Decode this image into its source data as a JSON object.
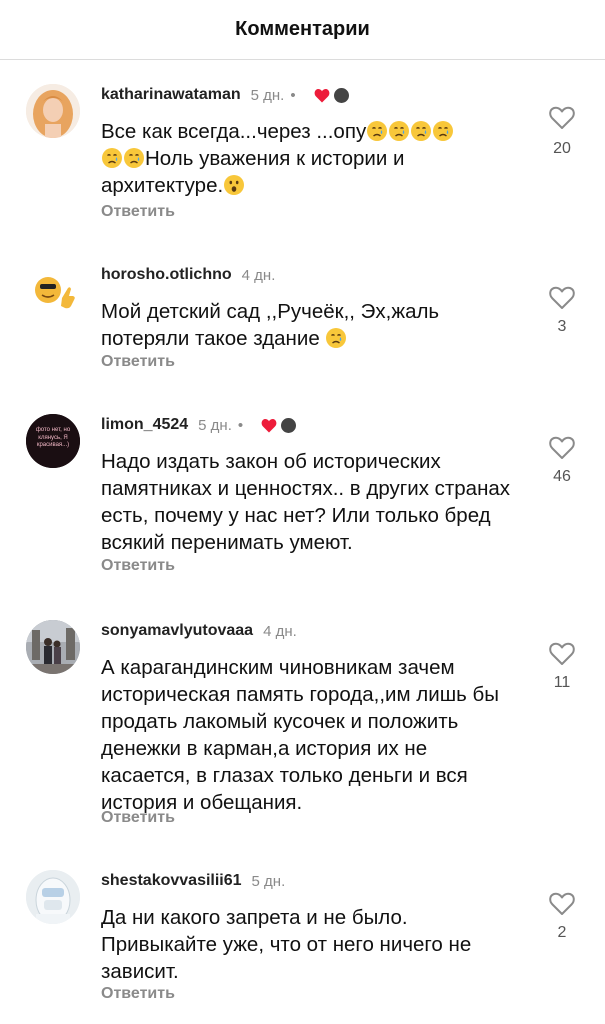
{
  "header": {
    "title": "Комментарии"
  },
  "reply_label": "Ответить",
  "comments": [
    {
      "username": "katharinawataman",
      "time": "5 дн.",
      "dot": "•",
      "text_parts": [
        "Все как всегда...через ...опу",
        "Ноль уважения к истории и архитектуре."
      ],
      "likes": "20",
      "author_liked": true
    },
    {
      "username": "horosho.otlichno",
      "time": "4 дн.",
      "text_parts": [
        "Мой детский сад ,,Ручеёк,, Эх,жаль потеряли такое здание "
      ],
      "likes": "3",
      "author_liked": false
    },
    {
      "username": "limon_4524",
      "time": "5 дн.",
      "dot": "•",
      "avatar_text": "фото нет, но клянусь, Я красивая...)",
      "text": "Надо издать закон об исторических памятниках и ценностях.. в других странах есть, почему у нас нет? Или только бред всякий перенимать умеют.",
      "likes": "46",
      "author_liked": true
    },
    {
      "username": "sonyamavlyutovaaa",
      "time": "4 дн.",
      "text": "А карагандинским чиновникам зачем историческая память города,,им лишь бы продать лакомый кусочек и положить денежки в карман,а история их не касается, в глазах только деньги и вся история и обещания.",
      "likes": "11",
      "author_liked": false
    },
    {
      "username": "shestakovvasilii61",
      "time": "5 дн.",
      "text": "Да ни какого запрета и не было. Привыкайте уже, что от него ничего не зависит.",
      "likes": "2",
      "author_liked": false
    }
  ],
  "colors": {
    "heart_red": "#ed1c3a",
    "muted": "#8a8a8a",
    "emoji_yellow": "#f8c73a",
    "tear_blue": "#4aa3e8"
  }
}
